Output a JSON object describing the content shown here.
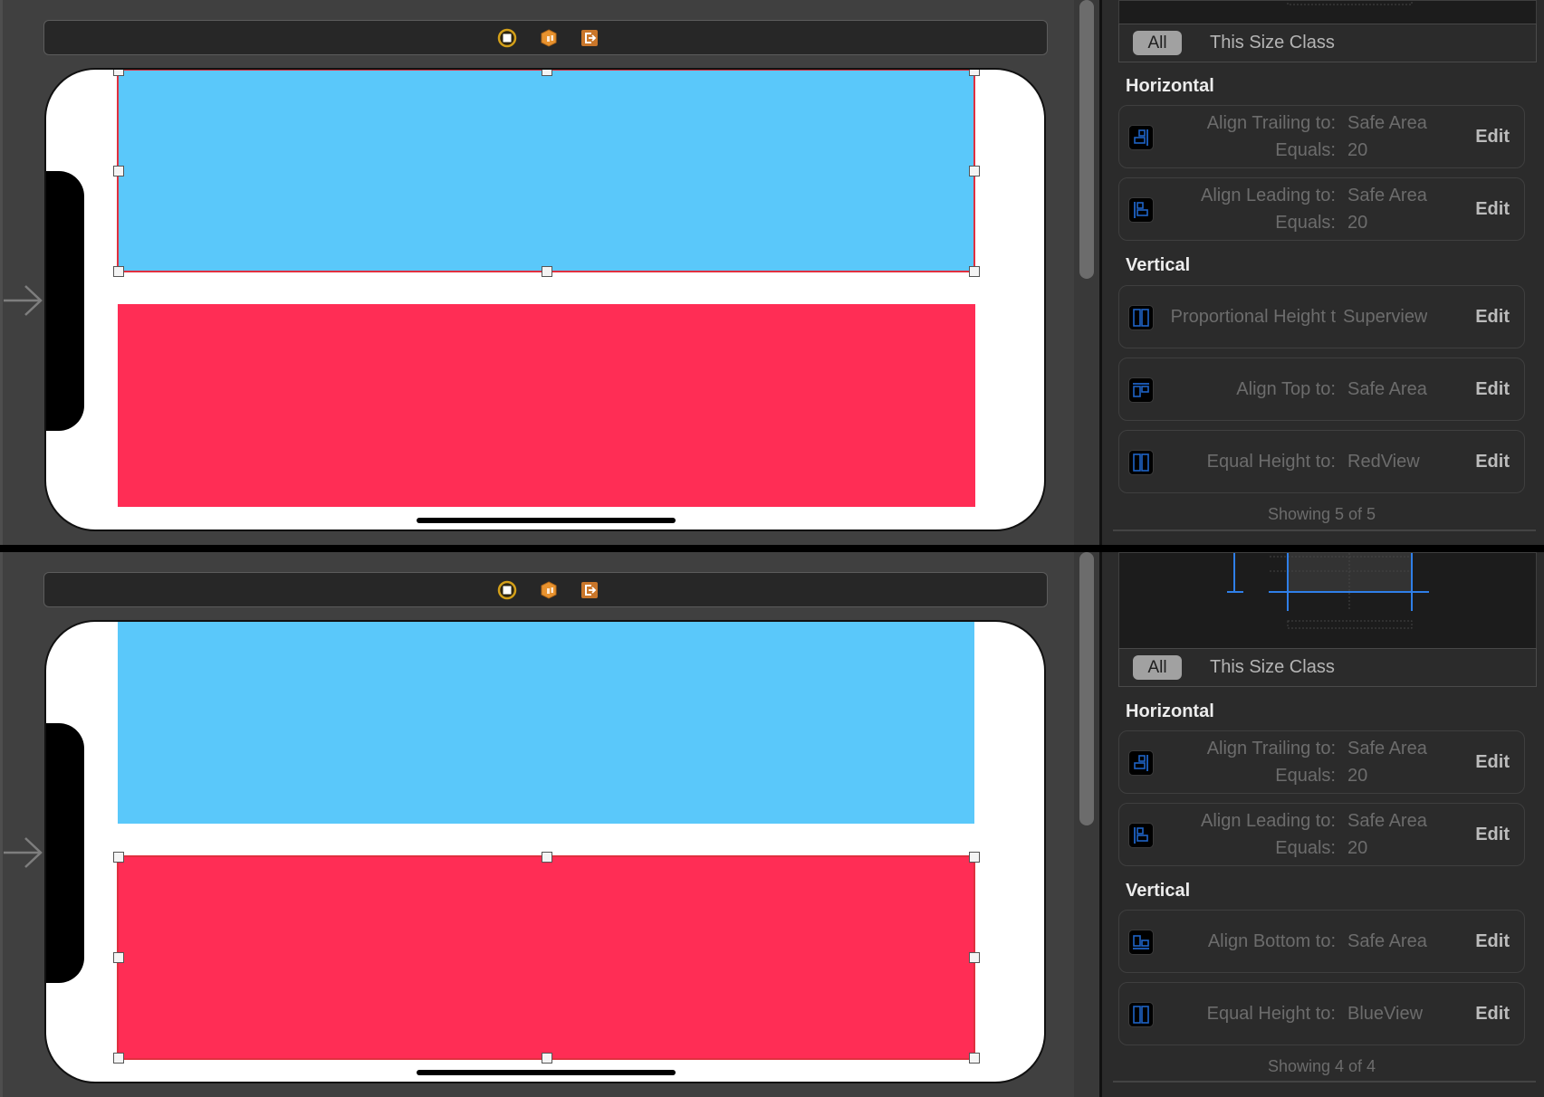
{
  "canvas": {
    "toolbar_icons": [
      {
        "name": "view-controller-icon",
        "color": "#d4a019"
      },
      {
        "name": "first-responder-icon",
        "color": "#e8922e"
      },
      {
        "name": "exit-icon",
        "color": "#c9762a"
      }
    ],
    "views": {
      "blue": {
        "name": "BlueView",
        "color": "#5ac8fa"
      },
      "red": {
        "name": "RedView",
        "color": "#ff2d55"
      }
    },
    "selection_color": "#e0303f"
  },
  "panes": [
    {
      "selected_view": "BlueView",
      "filter": {
        "all_label": "All",
        "size_class_label": "This Size Class",
        "selected": "All"
      },
      "sections": [
        {
          "title": "Horizontal",
          "constraints": [
            {
              "icon": "align-trailing-icon",
              "label": "Align Trailing to:",
              "target": "Safe Area",
              "constant_label": "Equals:",
              "constant": "20",
              "edit": "Edit"
            },
            {
              "icon": "align-leading-icon",
              "label": "Align Leading to:",
              "target": "Safe Area",
              "constant_label": "Equals:",
              "constant": "20",
              "edit": "Edit"
            }
          ]
        },
        {
          "title": "Vertical",
          "constraints": [
            {
              "icon": "proportional-height-icon",
              "label": "Proportional Height t",
              "target": "Superview",
              "edit": "Edit"
            },
            {
              "icon": "align-top-icon",
              "label": "Align Top to:",
              "target": "Safe Area",
              "edit": "Edit"
            },
            {
              "icon": "equal-height-icon",
              "label": "Equal Height to:",
              "target": "RedView",
              "edit": "Edit"
            }
          ]
        }
      ],
      "showing": "Showing 5 of 5"
    },
    {
      "selected_view": "RedView",
      "filter": {
        "all_label": "All",
        "size_class_label": "This Size Class",
        "selected": "All"
      },
      "sections": [
        {
          "title": "Horizontal",
          "constraints": [
            {
              "icon": "align-trailing-icon",
              "label": "Align Trailing to:",
              "target": "Safe Area",
              "constant_label": "Equals:",
              "constant": "20",
              "edit": "Edit"
            },
            {
              "icon": "align-leading-icon",
              "label": "Align Leading to:",
              "target": "Safe Area",
              "constant_label": "Equals:",
              "constant": "20",
              "edit": "Edit"
            }
          ]
        },
        {
          "title": "Vertical",
          "constraints": [
            {
              "icon": "align-bottom-icon",
              "label": "Align Bottom to:",
              "target": "Safe Area",
              "edit": "Edit"
            },
            {
              "icon": "equal-height-icon",
              "label": "Equal Height to:",
              "target": "BlueView",
              "edit": "Edit"
            }
          ]
        }
      ],
      "showing": "Showing 4 of 4"
    }
  ]
}
